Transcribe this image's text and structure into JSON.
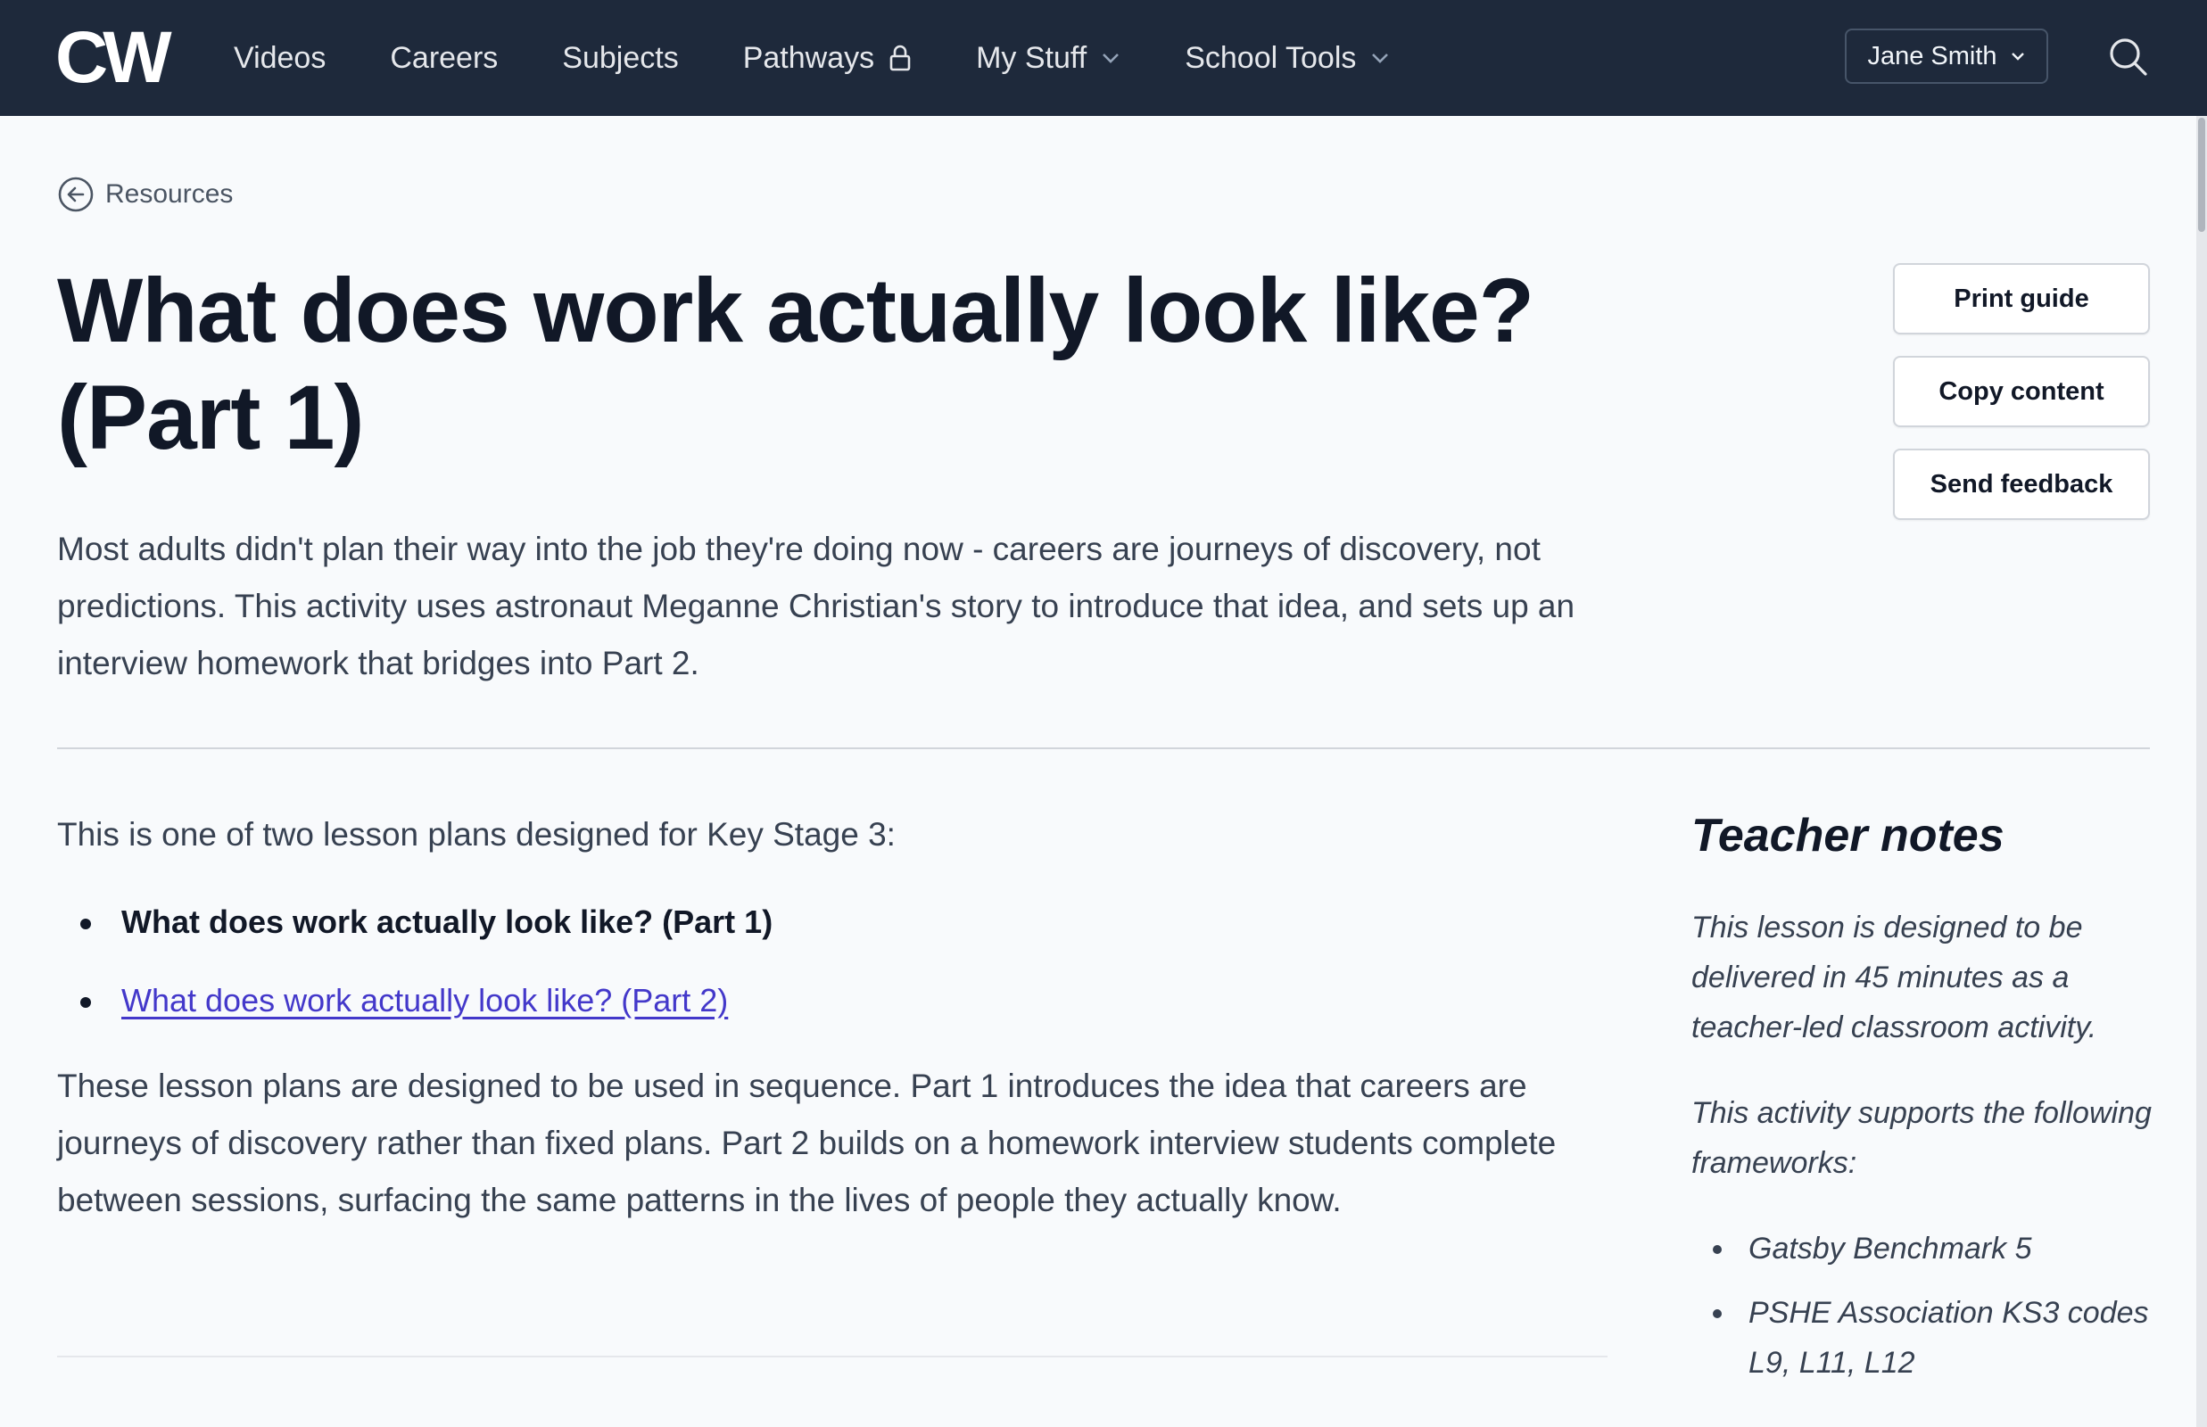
{
  "header": {
    "logo_text": "CW",
    "nav": [
      {
        "label": "Videos"
      },
      {
        "label": "Careers"
      },
      {
        "label": "Subjects"
      },
      {
        "label": "Pathways",
        "icon": "lock-icon"
      },
      {
        "label": "My Stuff",
        "icon": "chevron-down-icon"
      },
      {
        "label": "School Tools",
        "icon": "chevron-down-icon"
      }
    ],
    "user_name": "Jane Smith",
    "search_icon": "search-icon"
  },
  "breadcrumb": {
    "label": "Resources",
    "icon": "arrow-left-circle-icon"
  },
  "page": {
    "title_line1": "What does work actually look like?",
    "title_line2": "(Part 1)",
    "intro": "Most adults didn't plan their way into the job they're doing now - careers are journeys of discovery, not predictions. This activity uses astronaut Meganne Christian's story to introduce that idea, and sets up an interview homework that bridges into Part 2."
  },
  "actions": {
    "print_label": "Print guide",
    "copy_label": "Copy content",
    "feedback_label": "Send feedback"
  },
  "main": {
    "lead": "This is one of two lesson plans designed for Key Stage 3:",
    "lessons": [
      {
        "label": "What does work actually look like? (Part 1)",
        "current": true
      },
      {
        "label": "What does work actually look like? (Part 2)",
        "current": false
      }
    ],
    "paragraph": "These lesson plans are designed to be used in sequence. Part 1 introduces the idea that careers are journeys of discovery rather than fixed plans. Part 2 builds on a homework interview students complete between sessions, surfacing the same patterns in the lives of people they actually know."
  },
  "notes": {
    "title": "Teacher notes",
    "p1": "This lesson is designed to be delivered in 45 minutes as a teacher-led classroom activity.",
    "p2": "This activity supports the following frameworks:",
    "frameworks": [
      "Gatsby Benchmark 5",
      "PSHE Association KS3 codes L9, L11, L12"
    ]
  },
  "colors": {
    "topbar": "#1e293b",
    "background": "#f8fafc",
    "link": "#4338ca",
    "text": "#111827"
  }
}
